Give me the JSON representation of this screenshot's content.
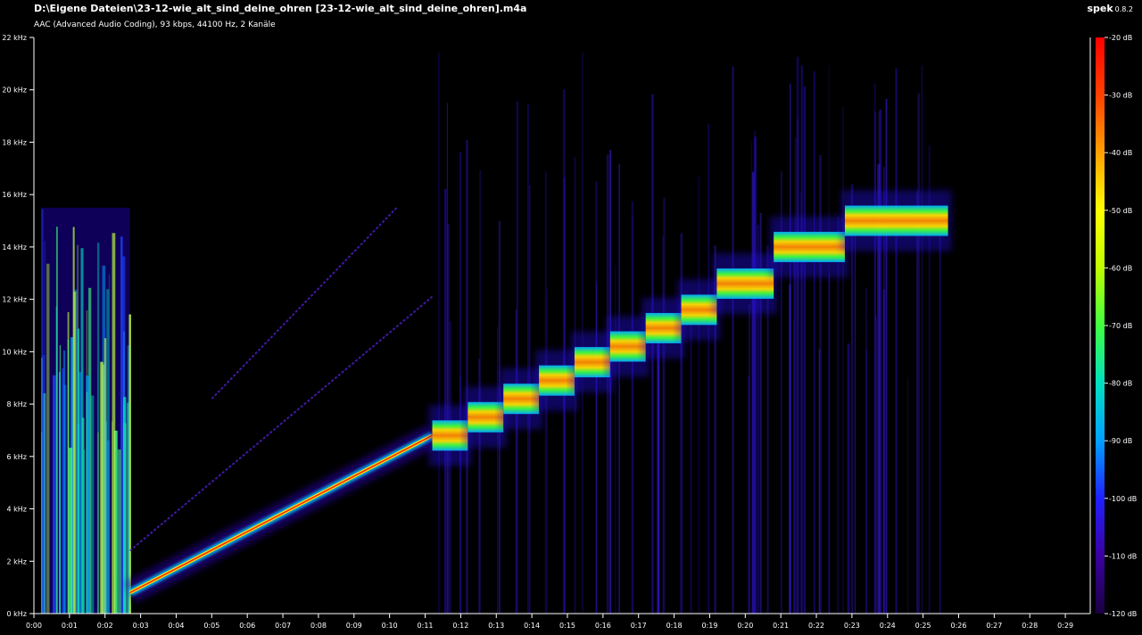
{
  "header": {
    "file_path": "D:\\Eigene Dateien\\23-12-wie_alt_sind_deine_ohren [23-12-wie_alt_sind_deine_ohren].m4a",
    "file_info": "AAC (Advanced Audio Coding), 93 kbps, 44100 Hz, 2 Kanäle",
    "app_name": "spek",
    "app_version": "0.8.2"
  },
  "colors": {
    "background": "#000000",
    "axis": "#ffffff",
    "sweep_low": "#2a00b0",
    "sweep_mid": "#00c8ff",
    "sweep_high": "#ffe000",
    "sweep_peak": "#ff2000"
  },
  "chart_data": {
    "type": "heatmap",
    "subtype": "spectrogram",
    "xlabel": "",
    "ylabel": "",
    "x_unit": "time (m:ss)",
    "xlim_seconds": [
      0,
      29.7
    ],
    "ylim_khz": [
      0,
      22
    ],
    "x_ticks": [
      "0:00",
      "0:01",
      "0:02",
      "0:03",
      "0:04",
      "0:05",
      "0:06",
      "0:07",
      "0:08",
      "0:09",
      "0:10",
      "0:11",
      "0:12",
      "0:13",
      "0:14",
      "0:15",
      "0:16",
      "0:17",
      "0:18",
      "0:19",
      "0:20",
      "0:21",
      "0:22",
      "0:23",
      "0:24",
      "0:25",
      "0:26",
      "0:27",
      "0:28",
      "0:29"
    ],
    "y_ticks": [
      "0 kHz",
      "2 kHz",
      "4 kHz",
      "6 kHz",
      "8 kHz",
      "10 kHz",
      "12 kHz",
      "14 kHz",
      "16 kHz",
      "18 kHz",
      "20 kHz",
      "22 kHz"
    ],
    "y_tick_values_khz": [
      0,
      2,
      4,
      6,
      8,
      10,
      12,
      14,
      16,
      18,
      20,
      22
    ],
    "colorbar": {
      "ticks": [
        "-20 dB",
        "-30 dB",
        "-40 dB",
        "-50 dB",
        "-60 dB",
        "-70 dB",
        "-80 dB",
        "-90 dB",
        "-100 dB",
        "-110 dB",
        "-120 dB"
      ],
      "range_db": [
        -120,
        -20
      ],
      "colors": [
        "#1a0040",
        "#3a00a0",
        "#2020ff",
        "#00a0ff",
        "#00e0c0",
        "#40ff40",
        "#c0ff00",
        "#ffff00",
        "#ffa000",
        "#ff4000",
        "#ff0000"
      ]
    },
    "series": [
      {
        "kind": "linear_sweep",
        "points_sec_khz": [
          [
            2.7,
            0.8
          ],
          [
            11.2,
            6.8
          ]
        ]
      },
      {
        "kind": "stepped_tones",
        "steps_sec_khz": [
          [
            11.2,
            12.2,
            6.8
          ],
          [
            12.2,
            13.2,
            7.5
          ],
          [
            13.2,
            14.2,
            8.2
          ],
          [
            14.2,
            15.2,
            8.9
          ],
          [
            15.2,
            16.2,
            9.6
          ],
          [
            16.2,
            17.2,
            10.2
          ],
          [
            17.2,
            18.2,
            10.9
          ],
          [
            18.2,
            19.2,
            11.6
          ],
          [
            19.2,
            20.8,
            12.6
          ],
          [
            20.8,
            22.8,
            14.0
          ],
          [
            22.8,
            25.7,
            15.0
          ]
        ]
      },
      {
        "kind": "noise_burst",
        "range_sec": [
          0.2,
          2.7
        ],
        "max_khz": 15.5
      },
      {
        "kind": "faint_harmonic",
        "points_sec_khz": [
          [
            2.7,
            2.4
          ],
          [
            11.2,
            12.1
          ]
        ]
      },
      {
        "kind": "faint_harmonic",
        "points_sec_khz": [
          [
            5.0,
            8.2
          ],
          [
            10.2,
            15.5
          ]
        ]
      }
    ]
  }
}
